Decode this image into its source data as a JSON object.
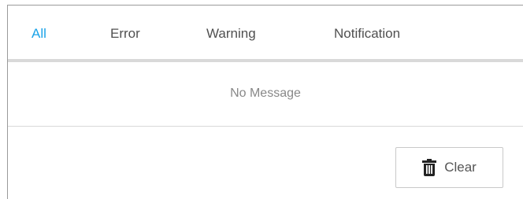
{
  "tabs": [
    {
      "label": "All",
      "active": true
    },
    {
      "label": "Error",
      "active": false
    },
    {
      "label": "Warning",
      "active": false
    },
    {
      "label": "Notification",
      "active": false
    }
  ],
  "empty_state": {
    "message": "No Message"
  },
  "actions": {
    "clear_label": "Clear",
    "clear_icon": "trash-icon"
  },
  "colors": {
    "active_tab": "#1aa3e8",
    "text": "#505050",
    "muted_text": "#888888",
    "divider": "#d9d9d9"
  }
}
